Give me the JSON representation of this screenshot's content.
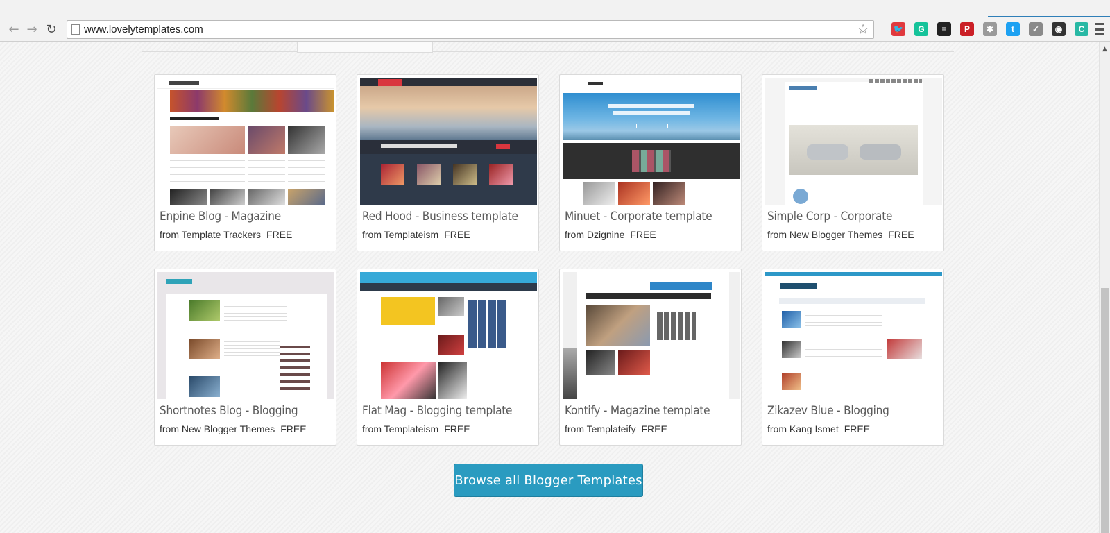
{
  "browser": {
    "url": "www.lovelytemplates.com",
    "extensions": [
      {
        "name": "twitter-bird-icon",
        "glyph": "🐦",
        "color": "#e0393e"
      },
      {
        "name": "grammarly-icon",
        "glyph": "G",
        "color": "#15c39a"
      },
      {
        "name": "buffer-icon",
        "glyph": "≡",
        "color": "#222222"
      },
      {
        "name": "pinterest-icon",
        "glyph": "P",
        "color": "#cb2027"
      },
      {
        "name": "puzzle-extension-icon",
        "glyph": "✱",
        "color": "#9a9a9a"
      },
      {
        "name": "twitter-square-icon",
        "glyph": "t",
        "color": "#1da1f2"
      },
      {
        "name": "checkmark-icon",
        "glyph": "✓",
        "color": "#8a8a8a"
      },
      {
        "name": "color-wheel-icon",
        "glyph": "◉",
        "color": "#333333"
      },
      {
        "name": "c-extension-icon",
        "glyph": "C",
        "color": "#28b8a4"
      }
    ]
  },
  "templates": [
    {
      "title": "Enpine Blog - Magazine",
      "source": "from Template Trackers",
      "price": "FREE"
    },
    {
      "title": "Red Hood - Business template",
      "source": "from Templateism",
      "price": "FREE"
    },
    {
      "title": "Minuet - Corporate template",
      "source": "from Dzignine",
      "price": "FREE"
    },
    {
      "title": "Simple Corp - Corporate",
      "source": "from New Blogger Themes",
      "price": "FREE"
    },
    {
      "title": "Shortnotes Blog - Blogging",
      "source": "from New Blogger Themes",
      "price": "FREE"
    },
    {
      "title": "Flat Mag - Blogging template",
      "source": "from Templateism",
      "price": "FREE"
    },
    {
      "title": "Kontify - Magazine template",
      "source": "from Templateify",
      "price": "FREE"
    },
    {
      "title": "Zikazev Blue - Blogging",
      "source": "from Kang Ismet",
      "price": "FREE"
    }
  ],
  "browse_button": "Browse all Blogger Templates",
  "accent_color": "#2a9bc0"
}
